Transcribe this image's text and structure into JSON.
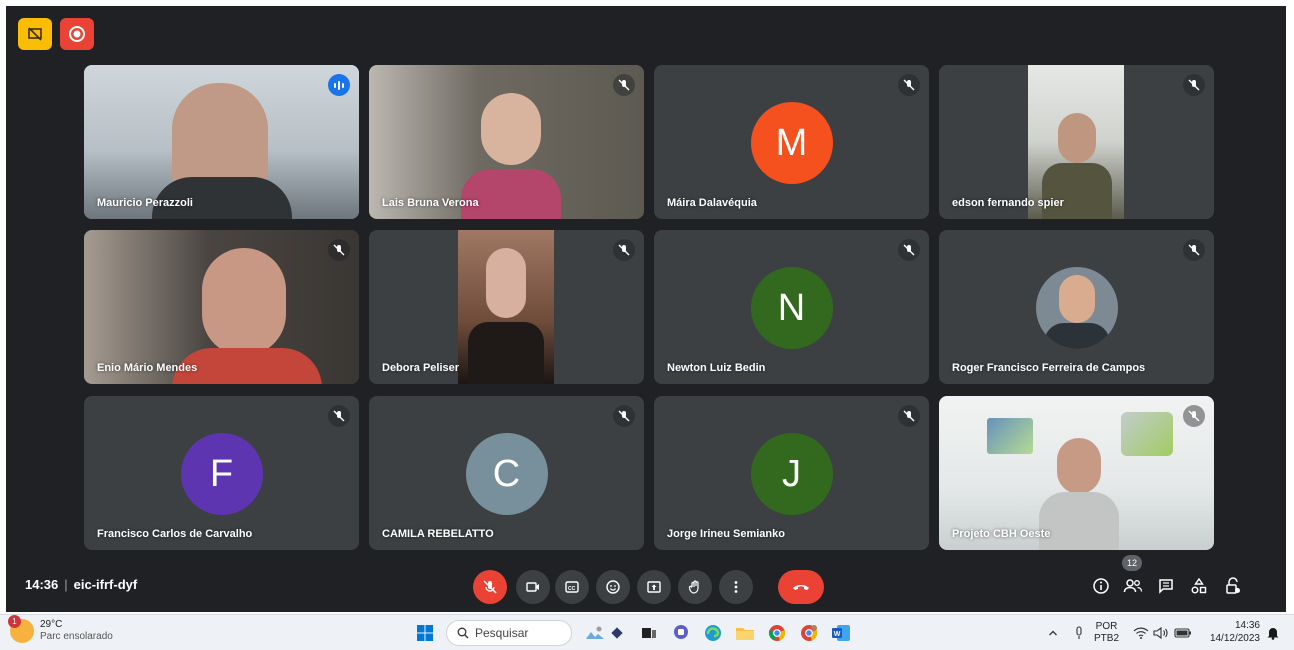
{
  "top_badges": {
    "presentation_icon": "no-presentation-icon",
    "record_icon": "record-icon"
  },
  "participants": [
    {
      "name": "Mauricio Perazzoli",
      "type": "video",
      "speaking": true,
      "muted": false
    },
    {
      "name": "Lais Bruna Verona",
      "type": "video",
      "speaking": false,
      "muted": true
    },
    {
      "name": "Máira Dalavéquia",
      "type": "avatar",
      "initial": "M",
      "color": "#f4511e",
      "muted": true
    },
    {
      "name": "edson fernando spier",
      "type": "video",
      "speaking": false,
      "muted": true
    },
    {
      "name": "Enio Mário Mendes",
      "type": "video",
      "speaking": false,
      "muted": true
    },
    {
      "name": "Debora Peliser",
      "type": "video",
      "speaking": false,
      "muted": true
    },
    {
      "name": "Newton Luiz Bedin",
      "type": "avatar",
      "initial": "N",
      "color": "#33691e",
      "muted": true
    },
    {
      "name": "Roger Francisco Ferreira de Campos",
      "type": "photo",
      "muted": true
    },
    {
      "name": "Francisco Carlos de Carvalho",
      "type": "avatar",
      "initial": "F",
      "color": "#5e35b1",
      "muted": true
    },
    {
      "name": "CAMILA REBELATTO",
      "type": "avatar",
      "initial": "C",
      "color": "#78909c",
      "muted": true
    },
    {
      "name": "Jorge Irineu Semianko",
      "type": "avatar",
      "initial": "J",
      "color": "#33691e",
      "muted": true
    },
    {
      "name": "Projeto CBH Oeste",
      "type": "video",
      "speaking": false,
      "muted": true
    }
  ],
  "meeting": {
    "time": "14:36",
    "code": "eic-ifrf-dyf"
  },
  "controls": [
    "mic-off-icon",
    "camera-icon",
    "captions-icon",
    "emoji-icon",
    "present-icon",
    "raise-hand-icon",
    "more-options-icon",
    "hang-up-icon"
  ],
  "right_controls": {
    "participant_count": "12"
  },
  "taskbar": {
    "weather": {
      "temp": "29°C",
      "condition": "Parc ensolarado",
      "alert_count": "1"
    },
    "search_placeholder": "Pesquisar",
    "lang": "POR",
    "layout": "PTB2",
    "clock_time": "14:36",
    "clock_date": "14/12/2023"
  }
}
